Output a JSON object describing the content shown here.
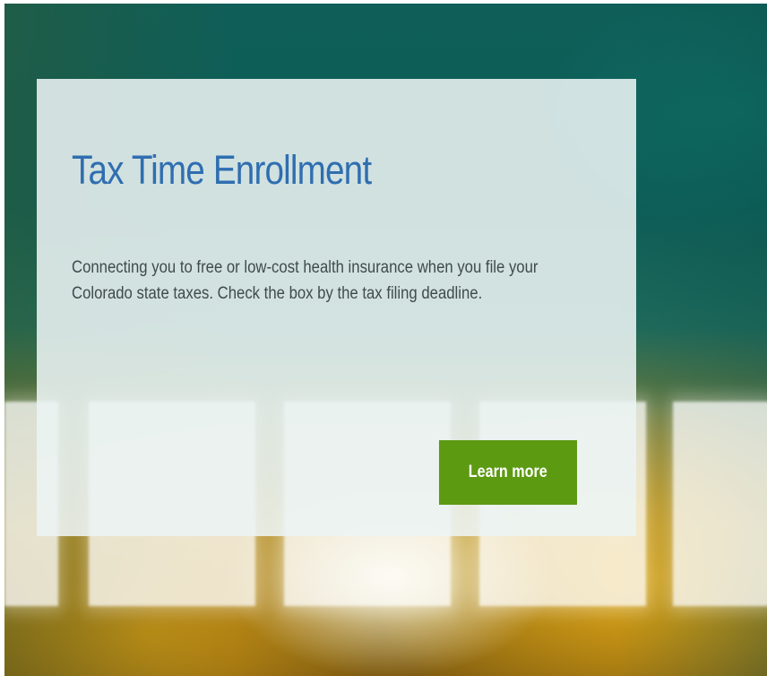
{
  "hero": {
    "title": "Tax Time Enrollment",
    "description": "Connecting you to free or low-cost health insurance when you file your Colorado state taxes. Check the box by the tax filing deadline.",
    "cta_label": "Learn more"
  },
  "colors": {
    "title": "#2f6eb0",
    "button": "#5c9a12",
    "background_teal": "#0f5e58",
    "background_gold": "#e2a814"
  }
}
